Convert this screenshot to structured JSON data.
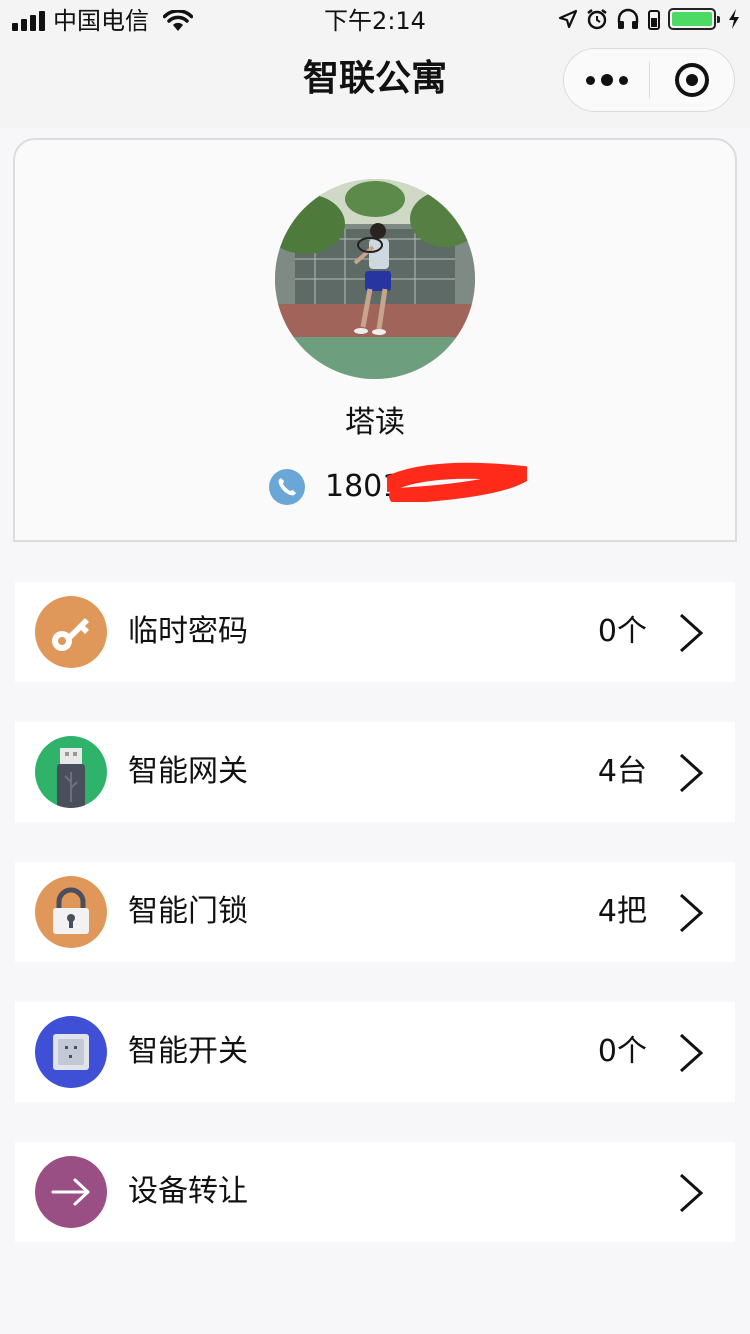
{
  "status_bar": {
    "carrier": "中国电信",
    "time": "下午2:14"
  },
  "nav": {
    "title": "智联公寓"
  },
  "profile": {
    "name": "塔读",
    "phone": "1801"
  },
  "menu": [
    {
      "label": "临时密码",
      "count": "0个",
      "icon": "key-icon",
      "color": "#e0975a"
    },
    {
      "label": "智能网关",
      "count": "4台",
      "icon": "usb-gateway-icon",
      "color": "#2fb36b"
    },
    {
      "label": "智能门锁",
      "count": "4把",
      "icon": "padlock-icon",
      "color": "#e0975a"
    },
    {
      "label": "智能开关",
      "count": "0个",
      "icon": "wall-switch-icon",
      "color": "#3f4fd6"
    },
    {
      "label": "设备转让",
      "count": "",
      "icon": "arrow-right-icon",
      "color": "#9a4f84"
    }
  ],
  "colors": {
    "phone_icon": "#6aa6d6",
    "battery": "#4cd964",
    "redaction": "#ff2a1a"
  }
}
